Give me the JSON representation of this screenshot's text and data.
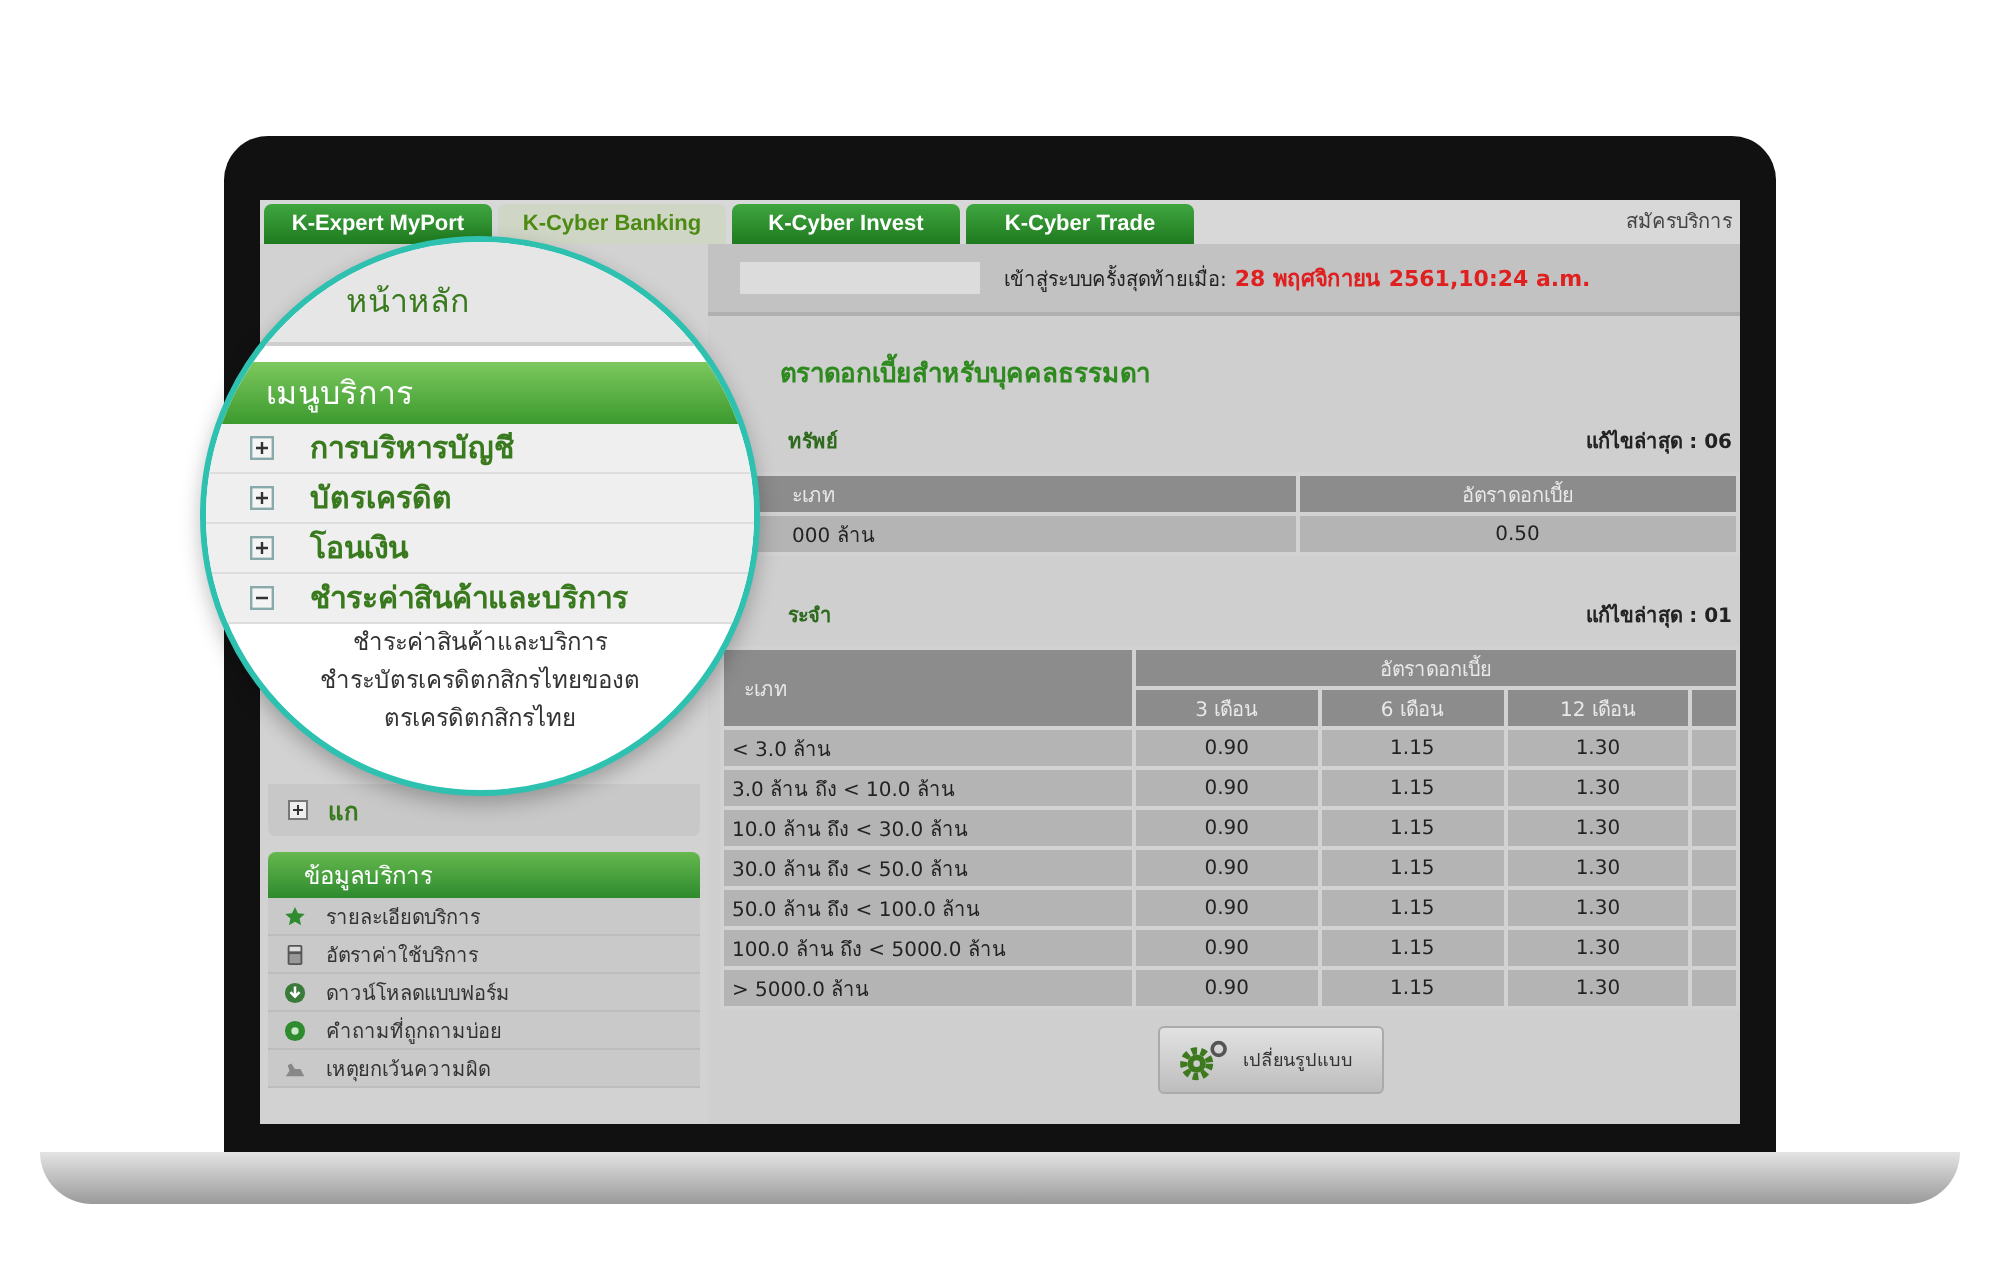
{
  "tabs": [
    {
      "label": "K-Expert MyPort",
      "selected": false
    },
    {
      "label": "K-Cyber Banking",
      "selected": true
    },
    {
      "label": "K-Cyber Invest",
      "selected": false
    },
    {
      "label": "K-Cyber Trade",
      "selected": false
    }
  ],
  "header_right": "สมัครบริการ",
  "login": {
    "label": "เข้าสู่ระบบครั้งสุดท้ายเมื่อ:",
    "value": "28 พฤศจิกายน 2561,10:24 a.m."
  },
  "magnifier": {
    "home": "หน้าหลัก",
    "menu_title": "เมนูบริการ",
    "menu": [
      {
        "label": "การบริหารบัญชี",
        "expanded": false
      },
      {
        "label": "บัตรเครดิต",
        "expanded": false
      },
      {
        "label": "โอนเงิน",
        "expanded": false
      },
      {
        "label": "ชำระค่าสินค้าและบริการ",
        "expanded": true,
        "children": [
          "ชำระค่าสินค้าและบริการ",
          "ชำระบัตรเครดิตกสิกรไทยของต",
          "ตรเครดิตกสิกรไทย"
        ]
      }
    ]
  },
  "sidebar": {
    "items": [
      {
        "label": "แก",
        "expanded": false
      }
    ],
    "info_title": "ข้อมูลบริการ",
    "info_items": [
      "รายละเอียดบริการ",
      "อัตราค่าใช้บริการ",
      "ดาวน์โหลดแบบฟอร์ม",
      "คำถามที่ถูกถามบ่อย",
      "เหตุยกเว้นความผิด"
    ]
  },
  "main": {
    "title": "ตราดอกเบี้ยสำหรับบุคคลธรรมดา",
    "savings": {
      "label": "ทรัพย์",
      "updated": "แก้ไขล่าสุด : 06",
      "columns": [
        "ะเภท",
        "อัตราดอกเบี้ย"
      ],
      "rows": [
        [
          "000 ล้าน",
          "0.50"
        ]
      ]
    },
    "fixed": {
      "label": "ระจำ",
      "updated": "แก้ไขล่าสุด : 01",
      "column_1": "ะเภท",
      "group": "อัตราดอกเบี้ย",
      "subcolumns": [
        "3 เดือน",
        "6 เดือน",
        "12 เดือน"
      ],
      "rows": [
        [
          "< 3.0 ล้าน",
          "0.90",
          "1.15",
          "1.30"
        ],
        [
          "3.0 ล้าน ถึง < 10.0 ล้าน",
          "0.90",
          "1.15",
          "1.30"
        ],
        [
          "10.0 ล้าน ถึง < 30.0 ล้าน",
          "0.90",
          "1.15",
          "1.30"
        ],
        [
          "30.0 ล้าน ถึง < 50.0 ล้าน",
          "0.90",
          "1.15",
          "1.30"
        ],
        [
          "50.0 ล้าน ถึง < 100.0 ล้าน",
          "0.90",
          "1.15",
          "1.30"
        ],
        [
          "100.0 ล้าน ถึง < 5000.0 ล้าน",
          "0.90",
          "1.15",
          "1.30"
        ],
        [
          "> 5000.0 ล้าน",
          "0.90",
          "1.15",
          "1.30"
        ]
      ]
    },
    "button": "เปลี่ยนรูปแบบ"
  }
}
